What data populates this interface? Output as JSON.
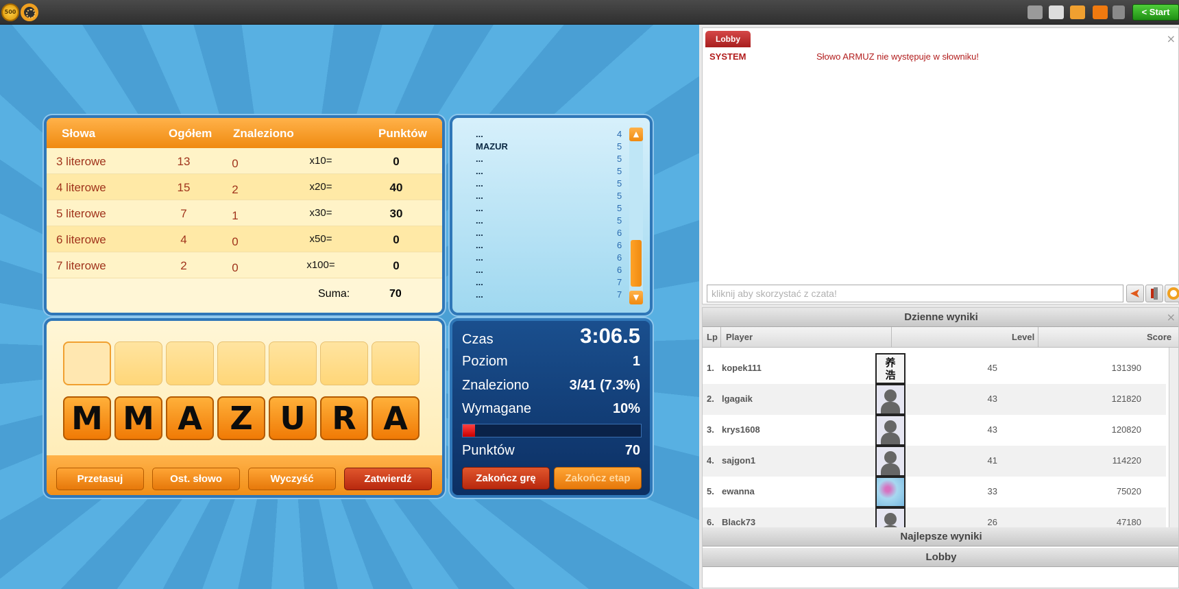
{
  "topbar": {
    "coin_text": "500",
    "start_label": "< Start",
    "icons": [
      "camera-icon",
      "news-icon",
      "friends-icon",
      "rss-icon",
      "sound-icon"
    ]
  },
  "scores": {
    "headers": {
      "words": "Słowa",
      "total": "Ogółem",
      "found": "Znaleziono",
      "points": "Punktów"
    },
    "rows": [
      {
        "label": "3 literowe",
        "total": "13",
        "found": "0",
        "mult": "x10=",
        "points": "0"
      },
      {
        "label": "4 literowe",
        "total": "15",
        "found": "2",
        "mult": "x20=",
        "points": "40"
      },
      {
        "label": "5 literowe",
        "total": "7",
        "found": "1",
        "mult": "x30=",
        "points": "30"
      },
      {
        "label": "6 literowe",
        "total": "4",
        "found": "0",
        "mult": "x50=",
        "points": "0"
      },
      {
        "label": "7 literowe",
        "total": "2",
        "found": "0",
        "mult": "x100=",
        "points": "0"
      }
    ],
    "sum_label": "Suma:",
    "sum_value": "70"
  },
  "wordlist": {
    "items": [
      {
        "word": "...",
        "len": "4"
      },
      {
        "word": "MAZUR",
        "len": "5"
      },
      {
        "word": "...",
        "len": "5"
      },
      {
        "word": "...",
        "len": "5"
      },
      {
        "word": "...",
        "len": "5"
      },
      {
        "word": "...",
        "len": "5"
      },
      {
        "word": "...",
        "len": "5"
      },
      {
        "word": "...",
        "len": "5"
      },
      {
        "word": "...",
        "len": "6"
      },
      {
        "word": "...",
        "len": "6"
      },
      {
        "word": "...",
        "len": "6"
      },
      {
        "word": "...",
        "len": "6"
      },
      {
        "word": "...",
        "len": "7"
      },
      {
        "word": "...",
        "len": "7"
      }
    ],
    "scroll_up": "▲",
    "scroll_down": "▼"
  },
  "board": {
    "tiles": [
      "M",
      "M",
      "A",
      "Z",
      "U",
      "R",
      "A"
    ],
    "buttons": {
      "shuffle": "Przetasuj",
      "last_word": "Ost. słowo",
      "clear": "Wyczyść",
      "confirm": "Zatwierdź"
    }
  },
  "status": {
    "time_label": "Czas",
    "time_value": "3:06.5",
    "level_label": "Poziom",
    "level_value": "1",
    "found_label": "Znaleziono",
    "found_value": "3/41 (7.3%)",
    "required_label": "Wymagane",
    "required_value": "10%",
    "required_progress": 0.07,
    "points_label": "Punktów",
    "points_value": "70",
    "end_game": "Zakończ grę",
    "end_stage": "Zakończ etap"
  },
  "chat": {
    "tab": "Lobby",
    "close": "×",
    "sender": "SYSTEM",
    "message": "Słowo ARMUZ nie występuje w słowniku!",
    "input_placeholder": "kliknij aby skorzystać z czata!"
  },
  "daily": {
    "title": "Dzienne wyniki",
    "close": "×",
    "columns": {
      "lp": "Lp",
      "player": "Player",
      "level": "Level",
      "score": "Score"
    },
    "players": [
      {
        "lp": "1.",
        "name": "kopek111",
        "level": "45",
        "score": "131390",
        "avatar": "kanji"
      },
      {
        "lp": "2.",
        "name": "lgagaik",
        "level": "43",
        "score": "121820",
        "avatar": "default"
      },
      {
        "lp": "3.",
        "name": "krys1608",
        "level": "43",
        "score": "120820",
        "avatar": "default"
      },
      {
        "lp": "4.",
        "name": "sajgon1",
        "level": "41",
        "score": "114220",
        "avatar": "default"
      },
      {
        "lp": "5.",
        "name": "ewanna",
        "level": "33",
        "score": "75020",
        "avatar": "flower"
      },
      {
        "lp": "6.",
        "name": "Black73",
        "level": "26",
        "score": "47180",
        "avatar": "default"
      }
    ],
    "avatar_kanji": "养\n浩"
  },
  "best": {
    "title": "Najlepsze wyniki"
  },
  "lobby": {
    "title": "Lobby"
  }
}
